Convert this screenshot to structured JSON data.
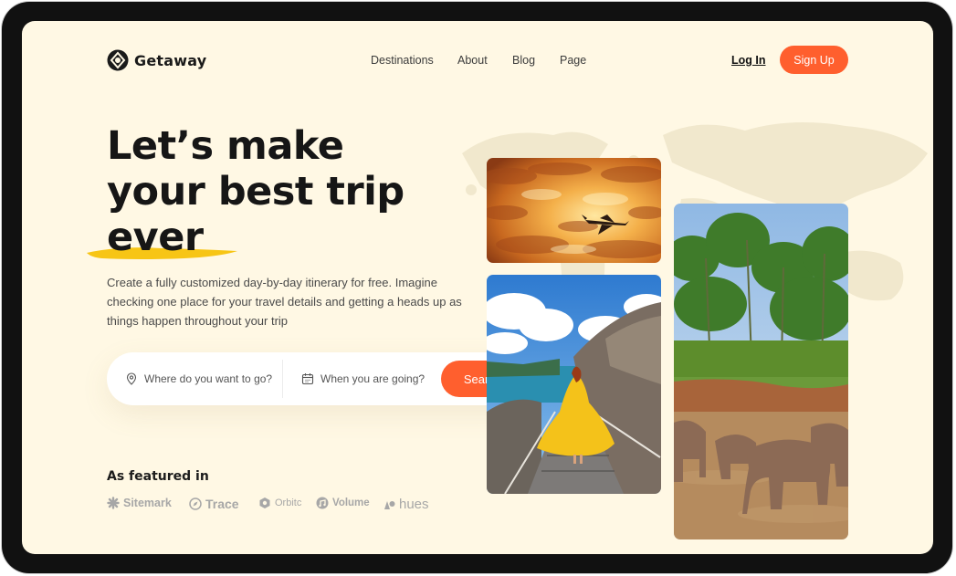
{
  "brand": {
    "name": "Getaway"
  },
  "nav": {
    "items": [
      "Destinations",
      "About",
      "Blog",
      "Page"
    ]
  },
  "auth": {
    "login_label": "Log In",
    "signup_label": "Sign Up"
  },
  "hero": {
    "title_lines": [
      "Let’s make",
      "your best trip",
      "ever"
    ],
    "description": "Create a fully customized day-by-day itinerary for free. Imagine checking one place for your travel details and getting a heads up as things happen throughout your trip"
  },
  "search": {
    "where_placeholder": "Where do you want to go?",
    "when_placeholder": "When you are going?",
    "button_label": "Search"
  },
  "featured": {
    "title": "As featured in",
    "brands": [
      "Sitemark",
      "Trace",
      "Orbitc",
      "Volume",
      "hues"
    ]
  },
  "colors": {
    "accent": "#ff5f2e",
    "background": "#fff8e4",
    "highlight": "#f7c515"
  },
  "icons": {
    "logo": "getaway-logo-icon",
    "where": "location-pin-icon",
    "when": "calendar-icon"
  }
}
